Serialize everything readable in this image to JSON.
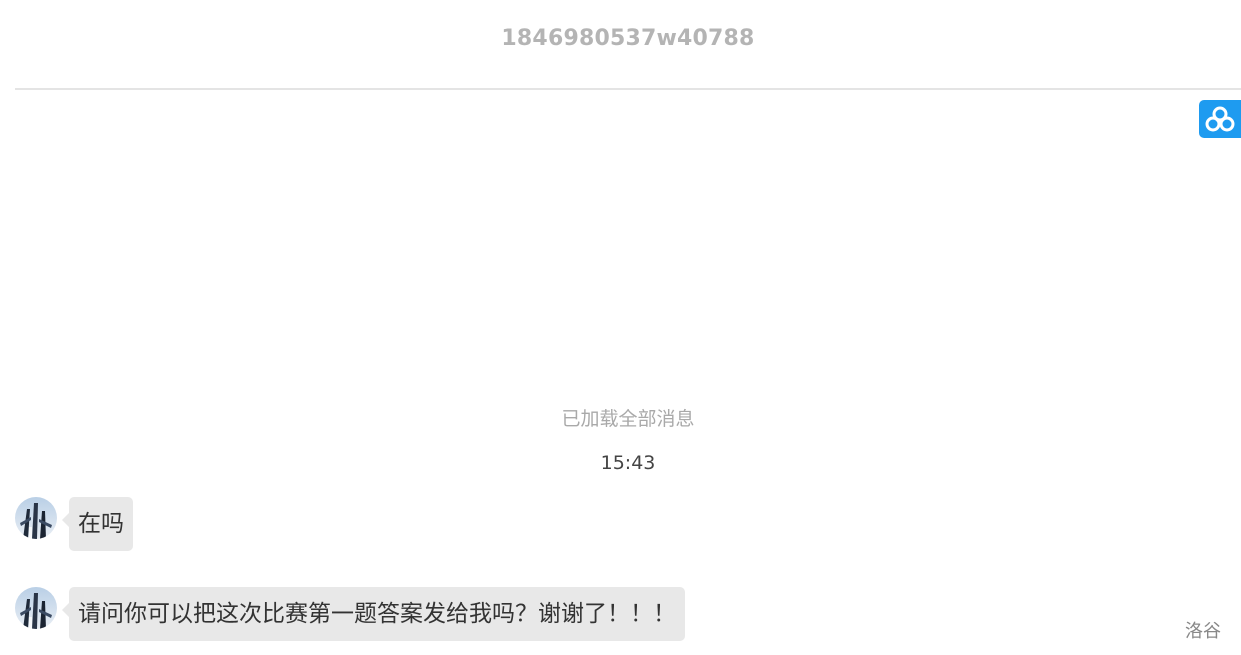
{
  "header": {
    "title": "1846980537w40788"
  },
  "float_button": {
    "icon": "cloud-share-icon",
    "color": "#1e9bf0"
  },
  "chat": {
    "loaded_note": "已加载全部消息",
    "timestamp": "15:43",
    "messages": [
      {
        "text": "在吗",
        "avatar_icon": "user-avatar"
      },
      {
        "text": "请问你可以把这次比赛第一题答案发给我吗？谢谢了！！！",
        "avatar_icon": "user-avatar"
      }
    ]
  },
  "watermark": "洛谷",
  "colors": {
    "bubble_bg": "#e8e8e8",
    "title_text": "#b4b4b4",
    "accent": "#1e9bf0"
  }
}
